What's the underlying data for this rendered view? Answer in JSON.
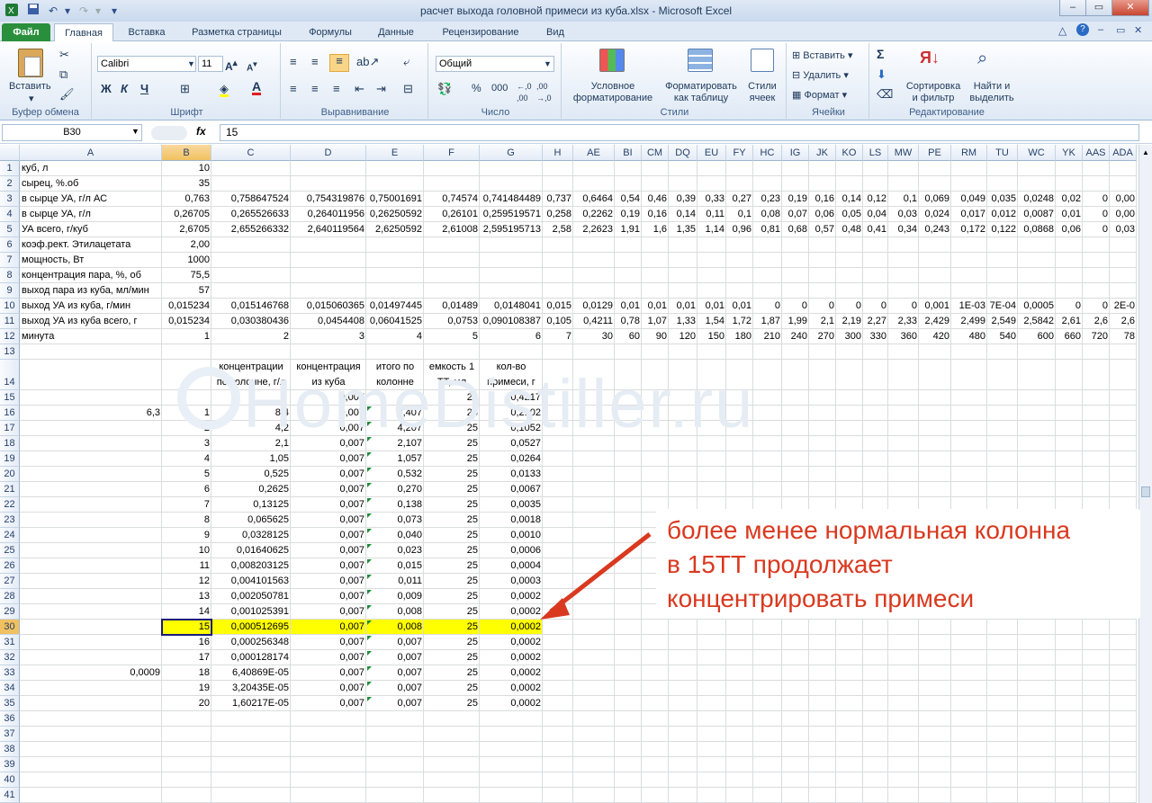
{
  "window": {
    "title": "расчет выхода головной примеси из куба.xlsx - Microsoft Excel"
  },
  "tabs": [
    "Файл",
    "Главная",
    "Вставка",
    "Разметка страницы",
    "Формулы",
    "Данные",
    "Рецензирование",
    "Вид"
  ],
  "ribbon": {
    "clipboard": {
      "label": "Буфер обмена",
      "paste": "Вставить"
    },
    "font": {
      "label": "Шрифт",
      "name": "Calibri",
      "size": "11",
      "bold": "Ж",
      "italic": "К",
      "underline": "Ч"
    },
    "align": {
      "label": "Выравнивание"
    },
    "number": {
      "label": "Число",
      "format": "Общий",
      "percent": "%",
      "thousands": "000"
    },
    "styles": {
      "label": "Стили",
      "cond": "Условное\nформатирование",
      "table": "Форматировать\nкак таблицу",
      "cell": "Стили\nячеек"
    },
    "cells": {
      "label": "Ячейки",
      "insert": "Вставить",
      "delete": "Удалить",
      "format": "Формат"
    },
    "edit": {
      "label": "Редактирование",
      "sort": "Сортировка\nи фильтр",
      "find": "Найти и\nвыделить",
      "sum": "Σ"
    }
  },
  "formula_bar": {
    "name_box": "B30",
    "fx": "fx",
    "value": "15"
  },
  "columns": [
    "A",
    "B",
    "C",
    "D",
    "E",
    "F",
    "G",
    "H",
    "AE",
    "BI",
    "CM",
    "DQ",
    "EU",
    "FY",
    "HC",
    "IG",
    "JK",
    "KO",
    "LS",
    "MW",
    "PE",
    "RM",
    "TU",
    "WC",
    "YK",
    "AAS",
    "ADA"
  ],
  "rows": [
    [
      "куб, л",
      "10",
      "",
      "",
      "",
      "",
      "",
      "",
      "",
      "",
      "",
      "",
      "",
      "",
      "",
      "",
      "",
      "",
      "",
      "",
      "",
      "",
      "",
      "",
      "",
      "",
      ""
    ],
    [
      "сырец, %.об",
      "35",
      "",
      "",
      "",
      "",
      "",
      "",
      "",
      "",
      "",
      "",
      "",
      "",
      "",
      "",
      "",
      "",
      "",
      "",
      "",
      "",
      "",
      "",
      "",
      "",
      ""
    ],
    [
      "в сырце УА, г/л АС",
      "0,763",
      "0,758647524",
      "0,754319876",
      "0,75001691",
      "0,74574",
      "0,741484489",
      "0,737",
      "0,6464",
      "0,54",
      "0,46",
      "0,39",
      "0,33",
      "0,27",
      "0,23",
      "0,19",
      "0,16",
      "0,14",
      "0,12",
      "0,1",
      "0,069",
      "0,049",
      "0,035",
      "0,0248",
      "0,02",
      "0",
      "0,00"
    ],
    [
      "в сырце УА, г/л",
      "0,26705",
      "0,265526633",
      "0,264011956",
      "0,26250592",
      "0,26101",
      "0,259519571",
      "0,258",
      "0,2262",
      "0,19",
      "0,16",
      "0,14",
      "0,11",
      "0,1",
      "0,08",
      "0,07",
      "0,06",
      "0,05",
      "0,04",
      "0,03",
      "0,024",
      "0,017",
      "0,012",
      "0,0087",
      "0,01",
      "0",
      "0,00"
    ],
    [
      "УА всего, г/куб",
      "2,6705",
      "2,655266332",
      "2,640119564",
      "2,6250592",
      "2,61008",
      "2,595195713",
      "2,58",
      "2,2623",
      "1,91",
      "1,6",
      "1,35",
      "1,14",
      "0,96",
      "0,81",
      "0,68",
      "0,57",
      "0,48",
      "0,41",
      "0,34",
      "0,243",
      "0,172",
      "0,122",
      "0,0868",
      "0,06",
      "0",
      "0,03"
    ],
    [
      "коэф.рект. Этилацетата",
      "2,00",
      "",
      "",
      "",
      "",
      "",
      "",
      "",
      "",
      "",
      "",
      "",
      "",
      "",
      "",
      "",
      "",
      "",
      "",
      "",
      "",
      "",
      "",
      "",
      "",
      ""
    ],
    [
      "мощность, Вт",
      "1000",
      "",
      "",
      "",
      "",
      "",
      "",
      "",
      "",
      "",
      "",
      "",
      "",
      "",
      "",
      "",
      "",
      "",
      "",
      "",
      "",
      "",
      "",
      "",
      "",
      ""
    ],
    [
      "концентрация пара, %, об",
      "75,5",
      "",
      "",
      "",
      "",
      "",
      "",
      "",
      "",
      "",
      "",
      "",
      "",
      "",
      "",
      "",
      "",
      "",
      "",
      "",
      "",
      "",
      "",
      "",
      "",
      ""
    ],
    [
      "выход пара из куба, мл/мин",
      "57",
      "",
      "",
      "",
      "",
      "",
      "",
      "",
      "",
      "",
      "",
      "",
      "",
      "",
      "",
      "",
      "",
      "",
      "",
      "",
      "",
      "",
      "",
      "",
      "",
      ""
    ],
    [
      "выход УА из куба, г/мин",
      "0,015234",
      "0,015146768",
      "0,015060365",
      "0,01497445",
      "0,01489",
      "0,0148041",
      "0,015",
      "0,0129",
      "0,01",
      "0,01",
      "0,01",
      "0,01",
      "0,01",
      "0",
      "0",
      "0",
      "0",
      "0",
      "0",
      "0,001",
      "1E-03",
      "7E-04",
      "0,0005",
      "0",
      "0",
      "2E-0"
    ],
    [
      "выход УА из куба всего, г",
      "0,015234",
      "0,030380436",
      "0,0454408",
      "0,06041525",
      "0,0753",
      "0,090108387",
      "0,105",
      "0,4211",
      "0,78",
      "1,07",
      "1,33",
      "1,54",
      "1,72",
      "1,87",
      "1,99",
      "2,1",
      "2,19",
      "2,27",
      "2,33",
      "2,429",
      "2,499",
      "2,549",
      "2,5842",
      "2,61",
      "2,6",
      "2,6"
    ],
    [
      "минута",
      "1",
      "2",
      "3",
      "4",
      "5",
      "6",
      "7",
      "30",
      "60",
      "90",
      "120",
      "150",
      "180",
      "210",
      "240",
      "270",
      "300",
      "330",
      "360",
      "420",
      "480",
      "540",
      "600",
      "660",
      "720",
      "78"
    ]
  ],
  "header14": [
    "концентрации по колонне, г/л",
    "концентрация из куба",
    "итого по колонне",
    "емкость 1 ТТ, мл",
    "кол-во примеси, г"
  ],
  "rows15": [
    [
      "",
      "",
      "",
      "0,007",
      "",
      "25",
      "0,4217"
    ],
    [
      "6,3",
      "1",
      "8,4",
      "0,007",
      "8,407",
      "25",
      "0,2102"
    ],
    [
      "",
      "2",
      "4,2",
      "0,007",
      "4,207",
      "25",
      "0,1052"
    ],
    [
      "",
      "3",
      "2,1",
      "0,007",
      "2,107",
      "25",
      "0,0527"
    ],
    [
      "",
      "4",
      "1,05",
      "0,007",
      "1,057",
      "25",
      "0,0264"
    ],
    [
      "",
      "5",
      "0,525",
      "0,007",
      "0,532",
      "25",
      "0,0133"
    ],
    [
      "",
      "6",
      "0,2625",
      "0,007",
      "0,270",
      "25",
      "0,0067"
    ],
    [
      "",
      "7",
      "0,13125",
      "0,007",
      "0,138",
      "25",
      "0,0035"
    ],
    [
      "",
      "8",
      "0,065625",
      "0,007",
      "0,073",
      "25",
      "0,0018"
    ],
    [
      "",
      "9",
      "0,0328125",
      "0,007",
      "0,040",
      "25",
      "0,0010"
    ],
    [
      "",
      "10",
      "0,01640625",
      "0,007",
      "0,023",
      "25",
      "0,0006"
    ],
    [
      "",
      "11",
      "0,008203125",
      "0,007",
      "0,015",
      "25",
      "0,0004"
    ],
    [
      "",
      "12",
      "0,004101563",
      "0,007",
      "0,011",
      "25",
      "0,0003"
    ],
    [
      "",
      "13",
      "0,002050781",
      "0,007",
      "0,009",
      "25",
      "0,0002"
    ],
    [
      "",
      "14",
      "0,001025391",
      "0,007",
      "0,008",
      "25",
      "0,0002"
    ],
    [
      "",
      "15",
      "0,000512695",
      "0,007",
      "0,008",
      "25",
      "0,0002"
    ],
    [
      "",
      "16",
      "0,000256348",
      "0,007",
      "0,007",
      "25",
      "0,0002"
    ],
    [
      "",
      "17",
      "0,000128174",
      "0,007",
      "0,007",
      "25",
      "0,0002"
    ],
    [
      "0,0009",
      "18",
      "6,40869E-05",
      "0,007",
      "0,007",
      "25",
      "0,0002"
    ],
    [
      "",
      "19",
      "3,20435E-05",
      "0,007",
      "0,007",
      "25",
      "0,0002"
    ],
    [
      "",
      "20",
      "1,60217E-05",
      "0,007",
      "0,007",
      "25",
      "0,0002"
    ]
  ],
  "row_numbers": [
    "1",
    "2",
    "3",
    "4",
    "5",
    "6",
    "7",
    "8",
    "9",
    "10",
    "11",
    "12",
    "13",
    "14",
    "15",
    "16",
    "17",
    "18",
    "19",
    "20",
    "21",
    "22",
    "23",
    "24",
    "25",
    "26",
    "27",
    "28",
    "29",
    "30",
    "31",
    "32",
    "33",
    "34",
    "35",
    "36",
    "37",
    "38",
    "39",
    "40",
    "41"
  ],
  "watermark": "HomeDistiller.ru",
  "annotation": {
    "lines": [
      "более менее нормальная колонна",
      "в 15ТТ продолжает",
      "концентрировать примеси"
    ],
    "color": "#d9391f"
  },
  "highlight_color": "#ffff00"
}
